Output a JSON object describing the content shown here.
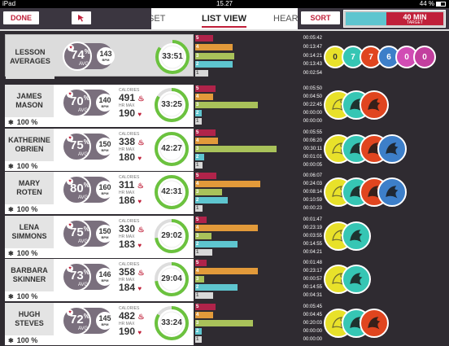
{
  "status": {
    "device": "iPad",
    "time": "15.27",
    "battery": "44 %"
  },
  "toolbar": {
    "done_label": "DONE",
    "sort_label": "SORT"
  },
  "tabs": {
    "set": "SET",
    "list": "LIST VIEW",
    "heart": "HEART"
  },
  "target": {
    "time": "40 MIN",
    "label": "TARGET"
  },
  "average": {
    "name": "LESSON AVERAGES",
    "pct": "74",
    "avg_label": "AVG",
    "hr": "143",
    "bpm": "BPM",
    "time": "33:51",
    "progress": 0.85,
    "times": [
      "00:05:42",
      "00:13:47",
      "00:14:21",
      "00:13:43",
      "00:02:54"
    ],
    "bars": [
      0.12,
      0.33,
      0.35,
      0.33,
      0.07
    ],
    "medal_counts": [
      "0",
      "7",
      "7",
      "6",
      "0",
      "0"
    ]
  },
  "labels": {
    "calories": "CALORIES",
    "hr_max": "HR MAX",
    "avg": "AVG",
    "bpm": "BPM",
    "pct_sign": "%"
  },
  "members": [
    {
      "first": "JAMES",
      "last": "MASON",
      "pct": "70",
      "hr": "140",
      "calories": "491",
      "hr_max": "190",
      "time": "33:25",
      "progress": 0.84,
      "bt": "100 %",
      "times": [
        "00:05:50",
        "00:04:50",
        "00:22:45",
        "00:00:00",
        "00:00:00"
      ],
      "bars": [
        0.15,
        0.12,
        0.6,
        0,
        0
      ],
      "medals": [
        "y",
        "t",
        "o"
      ]
    },
    {
      "first": "KATHERINE",
      "last": "OBRIEN",
      "pct": "75",
      "hr": "150",
      "calories": "338",
      "hr_max": "180",
      "time": "42:27",
      "progress": 1.0,
      "bt": "100 %",
      "times": [
        "00:05:55",
        "00:06:20",
        "00:30:11",
        "00:01:01",
        "00:00:05"
      ],
      "bars": [
        0.15,
        0.17,
        0.8,
        0.03,
        0.01
      ],
      "medals": [
        "y",
        "t",
        "o",
        "b"
      ]
    },
    {
      "first": "MARY",
      "last": "ROTEN",
      "pct": "80",
      "hr": "160",
      "calories": "311",
      "hr_max": "186",
      "time": "42:31",
      "progress": 1.0,
      "bt": "100 %",
      "times": [
        "00:06:07",
        "00:24:03",
        "00:08:14",
        "00:10:59",
        "00:00:23"
      ],
      "bars": [
        0.16,
        0.63,
        0.22,
        0.28,
        0.01
      ],
      "medals": [
        "y",
        "t",
        "o",
        "b"
      ]
    },
    {
      "first": "LENA",
      "last": "SIMMONS",
      "pct": "75",
      "hr": "150",
      "calories": "330",
      "hr_max": "183",
      "time": "29:02",
      "progress": 0.73,
      "bt": "100 %",
      "times": [
        "00:01:47",
        "00:23:19",
        "00:03:55",
        "00:14:55",
        "00:04:21"
      ],
      "bars": [
        0.05,
        0.6,
        0.1,
        0.38,
        0.11
      ],
      "medals": [
        "y",
        "t"
      ]
    },
    {
      "first": "BARBARA",
      "last": "SKINNER",
      "pct": "73",
      "hr": "146",
      "calories": "358",
      "hr_max": "184",
      "time": "29:04",
      "progress": 0.73,
      "bt": "100 %",
      "times": [
        "00:01:48",
        "00:23:17",
        "00:00:57",
        "00:14:55",
        "00:04:31"
      ],
      "bars": [
        0.05,
        0.6,
        0.03,
        0.38,
        0.12
      ],
      "medals": [
        "y",
        "t"
      ]
    },
    {
      "first": "HUGH",
      "last": "STEVES",
      "pct": "72",
      "hr": "145",
      "calories": "482",
      "hr_max": "190",
      "time": "33:24",
      "progress": 0.84,
      "bt": "100 %",
      "times": [
        "00:05:45",
        "00:04:45",
        "00:20:03",
        "00:00:00",
        "00:00:00"
      ],
      "bars": [
        0.15,
        0.12,
        0.55,
        0,
        0
      ],
      "medals": [
        "y",
        "t",
        "o"
      ]
    }
  ],
  "zone_colors": [
    "#b0234a",
    "#e29a3a",
    "#a9c25a",
    "#5ec5cf",
    "#d8d8d8"
  ],
  "zone_numbers": [
    "5",
    "4",
    "3",
    "2",
    "1"
  ],
  "medal_icons": {
    "y": "yellow-zone-medal-icon",
    "t": "tiger-medal-icon",
    "o": "panther-medal-icon",
    "b": "wolf-medal-icon"
  }
}
